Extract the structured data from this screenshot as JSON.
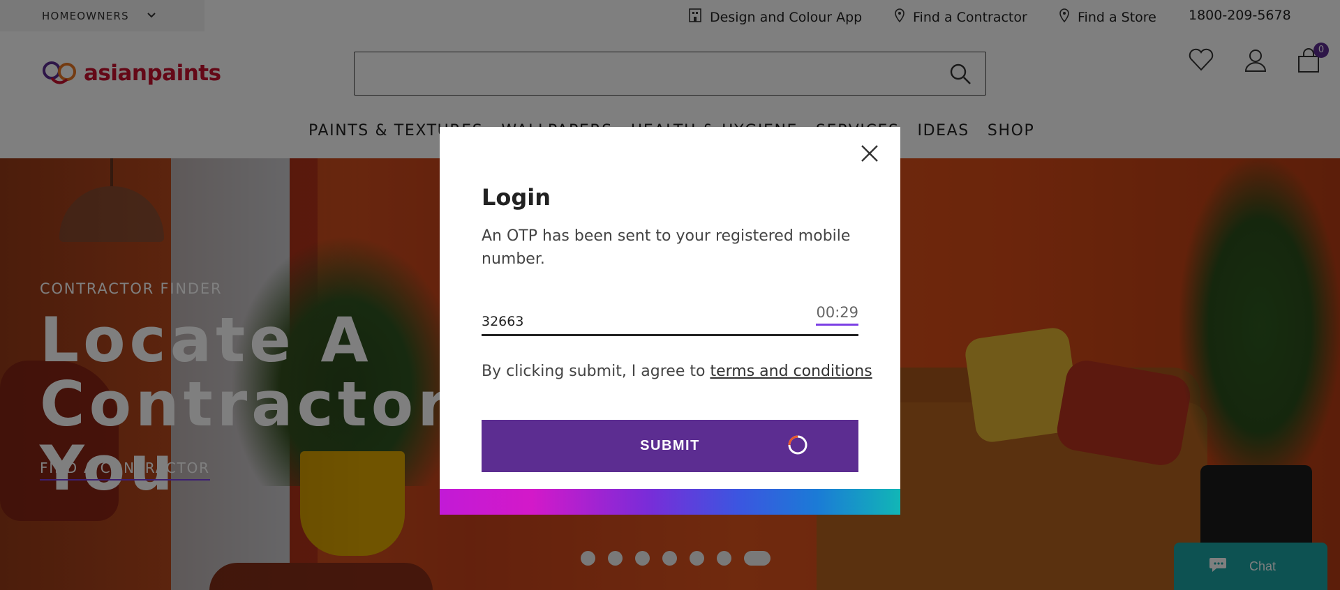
{
  "topbar": {
    "segment": "HOMEOWNERS",
    "links": {
      "design_app": "Design and Colour App",
      "find_contractor": "Find a Contractor",
      "find_store": "Find a Store",
      "phone": "1800-209-5678"
    }
  },
  "header": {
    "logo_text": "asianpaints",
    "search": {
      "value": "",
      "placeholder": ""
    },
    "cart_count": "0"
  },
  "nav": {
    "items": [
      "PAINTS & TEXTURES",
      "WALLPAPERS",
      "HEALTH & HYGIENE",
      "SERVICES",
      "IDEAS",
      "SHOP"
    ]
  },
  "hero": {
    "kicker": "CONTRACTOR FINDER",
    "title": "Locate A Contractor Near You",
    "cta": "FIND A CONTRACTOR",
    "slide_count": 7,
    "active_slide": 7
  },
  "chat": {
    "label": "Chat"
  },
  "modal": {
    "title": "Login",
    "message": "An OTP has been sent to your registered mobile number.",
    "otp_value": "32663",
    "timer": "00:29",
    "terms_prefix": "By clicking submit, I agree to ",
    "terms_link": "terms and conditions",
    "submit_label": "SUBMIT"
  },
  "colors": {
    "brand_purple": "#5c2d91",
    "accent_purple": "#7b3fe4",
    "logo_red": "#c8102e",
    "chat_teal": "#1aa5a5"
  },
  "icons": [
    "chevron-down-icon",
    "building-icon",
    "location-pin-icon",
    "search-icon",
    "heart-icon",
    "user-icon",
    "cart-icon",
    "close-icon",
    "chat-bubble-icon",
    "spinner-icon"
  ]
}
